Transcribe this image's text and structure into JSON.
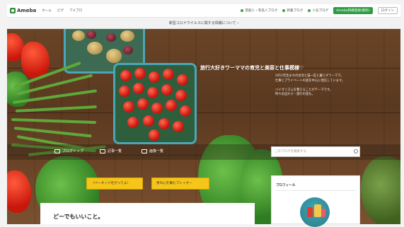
{
  "topbar": {
    "logo": "Ameba",
    "nav": [
      "ホーム",
      "ピグ",
      "アメブロ"
    ],
    "right_links": [
      "芸能人・有名人ブログ",
      "新着ブログ",
      "人気ブログ"
    ],
    "signup_button": "Ameba新規登録(無料)",
    "login_button": "ログイン"
  },
  "notice": {
    "text": "新型コロナウイルスに関する情報について ›"
  },
  "hero": {
    "title": "旅行大好きワーママの育児と美容と仕事模様♡",
    "description": [
      "2011年生まれの女児と猫一匹と暮らすワーママ。",
      "仕事とプライベートの話を中心に発信しています。",
      "",
      "バイオリズムを整えることがテーマです。",
      "時々お出かけ・旅行の話も。"
    ]
  },
  "blognav": {
    "items": [
      "ブログトップ",
      "記事一覧",
      "画像一覧"
    ],
    "search_placeholder": "このブログを検索する"
  },
  "buttons": {
    "follow": "〈ベーネッド社がってよ〉",
    "reader": "男の心を鷲むブレイオー"
  },
  "article": {
    "title": "どーでもいいこと。"
  },
  "profile": {
    "title": "プロフィール"
  },
  "colors": {
    "accent_green": "#2e9d44",
    "button_yellow": "#f6c51a"
  }
}
